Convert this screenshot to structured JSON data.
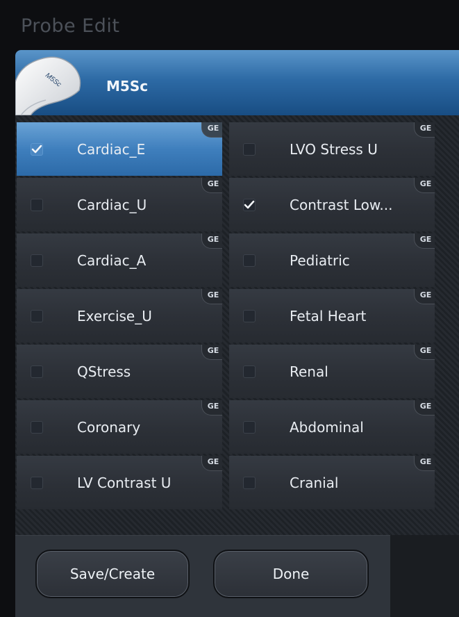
{
  "window": {
    "title": "Probe Edit"
  },
  "probe": {
    "name": "M5Sc",
    "image_label": "M5Sc"
  },
  "presets": [
    {
      "label": "Cardiac_E",
      "checked": true,
      "badge": "GE"
    },
    {
      "label": "LVO Stress U",
      "checked": false,
      "badge": "GE"
    },
    {
      "label": "Cardiac_U",
      "checked": false,
      "badge": "GE"
    },
    {
      "label": "Contrast Low...",
      "checked": true,
      "badge": "GE"
    },
    {
      "label": "Cardiac_A",
      "checked": false,
      "badge": "GE"
    },
    {
      "label": "Pediatric",
      "checked": false,
      "badge": "GE"
    },
    {
      "label": "Exercise_U",
      "checked": false,
      "badge": "GE"
    },
    {
      "label": "Fetal Heart",
      "checked": false,
      "badge": "GE"
    },
    {
      "label": "QStress",
      "checked": false,
      "badge": "GE"
    },
    {
      "label": "Renal",
      "checked": false,
      "badge": "GE"
    },
    {
      "label": "Coronary",
      "checked": false,
      "badge": "GE"
    },
    {
      "label": "Abdominal",
      "checked": false,
      "badge": "GE"
    },
    {
      "label": "LV Contrast U",
      "checked": false,
      "badge": "GE"
    },
    {
      "label": "Cranial",
      "checked": false,
      "badge": "GE"
    }
  ],
  "selected_preset": "Cardiac_E",
  "buttons": {
    "save_label": "Save/Create",
    "done_label": "Done"
  },
  "colors": {
    "header_blue": "#2d6aa5",
    "selected_blue": "#3f7fbd",
    "cell_bg": "#2c3037"
  }
}
